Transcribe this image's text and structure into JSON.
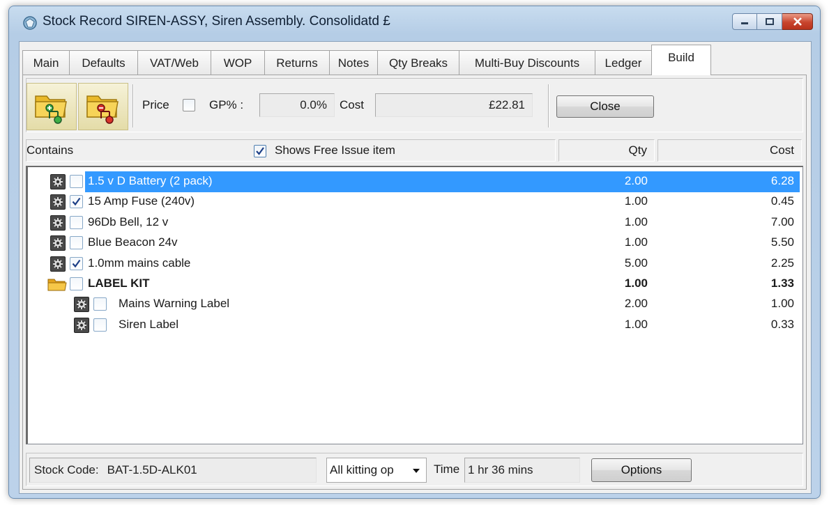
{
  "window": {
    "title": "Stock Record SIREN-ASSY, Siren Assembly. Consolidatd £"
  },
  "tabs": [
    {
      "label": "Main"
    },
    {
      "label": "Defaults"
    },
    {
      "label": "VAT/Web"
    },
    {
      "label": "WOP"
    },
    {
      "label": "Returns"
    },
    {
      "label": "Notes"
    },
    {
      "label": "Qty Breaks"
    },
    {
      "label": "Multi-Buy Discounts"
    },
    {
      "label": "Ledger"
    },
    {
      "label": "Build",
      "active": true
    }
  ],
  "toolbar": {
    "add_icon": "folder-add-icon",
    "remove_icon": "folder-remove-icon",
    "price_label": "Price",
    "price_checked": false,
    "gp_label": "GP% :",
    "gp_value": "0.0%",
    "cost_label": "Cost",
    "cost_value": "£22.81",
    "close_label": "Close"
  },
  "headers": {
    "contains": "Contains",
    "free_issue_label": "Shows Free Issue item",
    "free_issue_checked": true,
    "qty": "Qty",
    "cost": "Cost"
  },
  "items": [
    {
      "name": "1.5 v D Battery (2 pack)",
      "qty": "2.00",
      "cost": "6.28",
      "checked": false,
      "level": 0,
      "type": "item",
      "selected": true
    },
    {
      "name": "15 Amp Fuse (240v)",
      "qty": "1.00",
      "cost": "0.45",
      "checked": true,
      "level": 0,
      "type": "item"
    },
    {
      "name": "96Db Bell, 12 v",
      "qty": "1.00",
      "cost": "7.00",
      "checked": false,
      "level": 0,
      "type": "item"
    },
    {
      "name": "Blue Beacon 24v",
      "qty": "1.00",
      "cost": "5.50",
      "checked": false,
      "level": 0,
      "type": "item"
    },
    {
      "name": "1.0mm mains cable",
      "qty": "5.00",
      "cost": "2.25",
      "checked": true,
      "level": 0,
      "type": "item"
    },
    {
      "name": "LABEL KIT",
      "qty": "1.00",
      "cost": "1.33",
      "checked": false,
      "level": 0,
      "type": "kit"
    },
    {
      "name": "Mains Warning Label",
      "qty": "2.00",
      "cost": "1.00",
      "checked": false,
      "level": 1,
      "type": "item"
    },
    {
      "name": "Siren Label",
      "qty": "1.00",
      "cost": "0.33",
      "checked": false,
      "level": 1,
      "type": "item"
    }
  ],
  "status": {
    "stock_code_label": "Stock Code:",
    "stock_code_value": "BAT-1.5D-ALK01",
    "kitting_select": "All kitting op",
    "time_label": "Time",
    "time_value": "1 hr 36 mins",
    "options_label": "Options"
  },
  "colors": {
    "selection": "#3399ff",
    "window_frame": "#b5cde6",
    "close_button": "#c8452d"
  }
}
